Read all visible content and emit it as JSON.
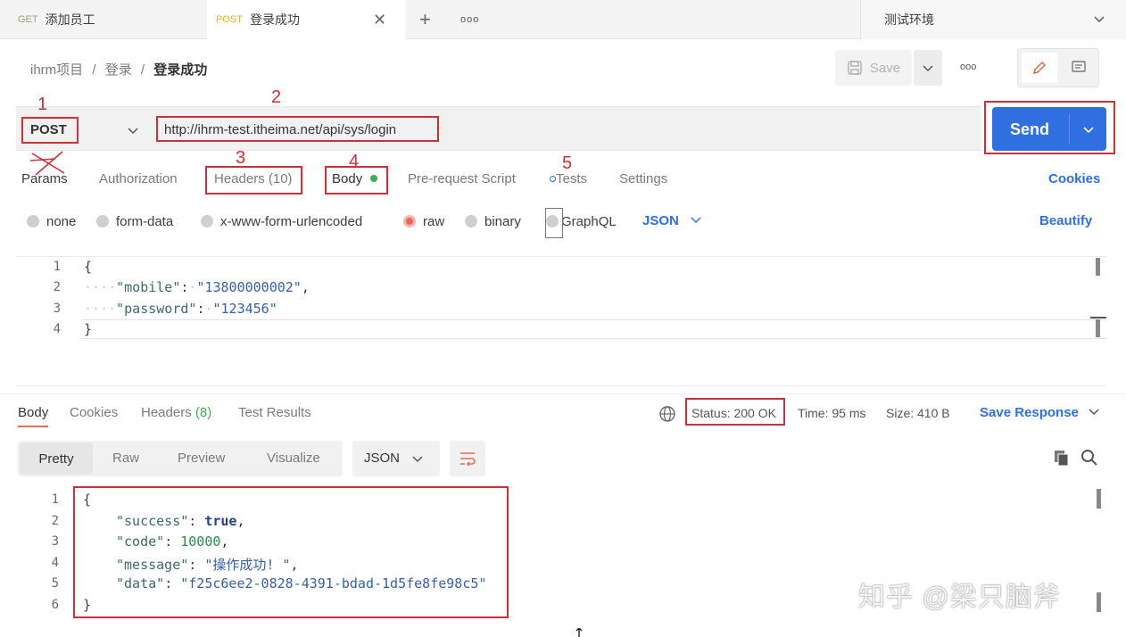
{
  "tabs": [
    {
      "method": "GET",
      "label": "添加员工"
    },
    {
      "method": "POST",
      "label": "登录成功"
    }
  ],
  "tab_close": "✕",
  "tab_add": "+",
  "tab_more": "ooo",
  "environment": "测试环境",
  "breadcrumb": {
    "project": "ihrm项目",
    "sep": "/",
    "folder": "登录",
    "current": "登录成功"
  },
  "toolbar": {
    "save": "Save",
    "more": "ooo"
  },
  "request": {
    "method": "POST",
    "url": "http://ihrm-test.itheima.net/api/sys/login",
    "send": "Send"
  },
  "req_tabs": {
    "params": "Params",
    "authorization": "Authorization",
    "headers": "Headers (10)",
    "body": "Body",
    "prerequest": "Pre-request Script",
    "tests": "Tests",
    "settings": "Settings",
    "cookies": "Cookies"
  },
  "body_types": {
    "none": "none",
    "form_data": "form-data",
    "urlencoded": "x-www-form-urlencoded",
    "raw": "raw",
    "binary": "binary",
    "graphql": "GraphQL",
    "format": "JSON",
    "beautify": "Beautify"
  },
  "request_body": {
    "line_numbers": [
      "1",
      "2",
      "3",
      "4"
    ],
    "open": "{",
    "k1": "\"mobile\"",
    "v1": "\"13800000002\"",
    "k2": "\"password\"",
    "v2": "\"123456\"",
    "close": "}"
  },
  "response_tabs": {
    "body": "Body",
    "cookies": "Cookies",
    "headers": "Headers",
    "headers_count": "(8)",
    "test_results": "Test Results"
  },
  "response_meta": {
    "status": "Status: 200 OK",
    "time": "Time: 95 ms",
    "size": "Size: 410 B",
    "save_response": "Save Response"
  },
  "view_modes": {
    "pretty": "Pretty",
    "raw": "Raw",
    "preview": "Preview",
    "visualize": "Visualize",
    "format": "JSON"
  },
  "response_body": {
    "line_numbers": [
      "1",
      "2",
      "3",
      "4",
      "5",
      "6"
    ],
    "open": "{",
    "k_success": "\"success\"",
    "v_success": "true",
    "k_code": "\"code\"",
    "v_code": "10000",
    "k_message": "\"message\"",
    "v_message": "\"操作成功! \"",
    "k_data": "\"data\"",
    "v_data": "\"f25c6ee2-0828-4391-bdad-1d5fe8fe98c5\"",
    "close": "}"
  },
  "annotations": [
    "1",
    "2",
    "3",
    "4",
    "5"
  ],
  "watermark": "知乎 @梁只脑斧",
  "colors": {
    "accent": "#2f6fe0",
    "highlight": "#c8323a",
    "method_post": "#e6b229",
    "body_dot": "#3faa55"
  }
}
